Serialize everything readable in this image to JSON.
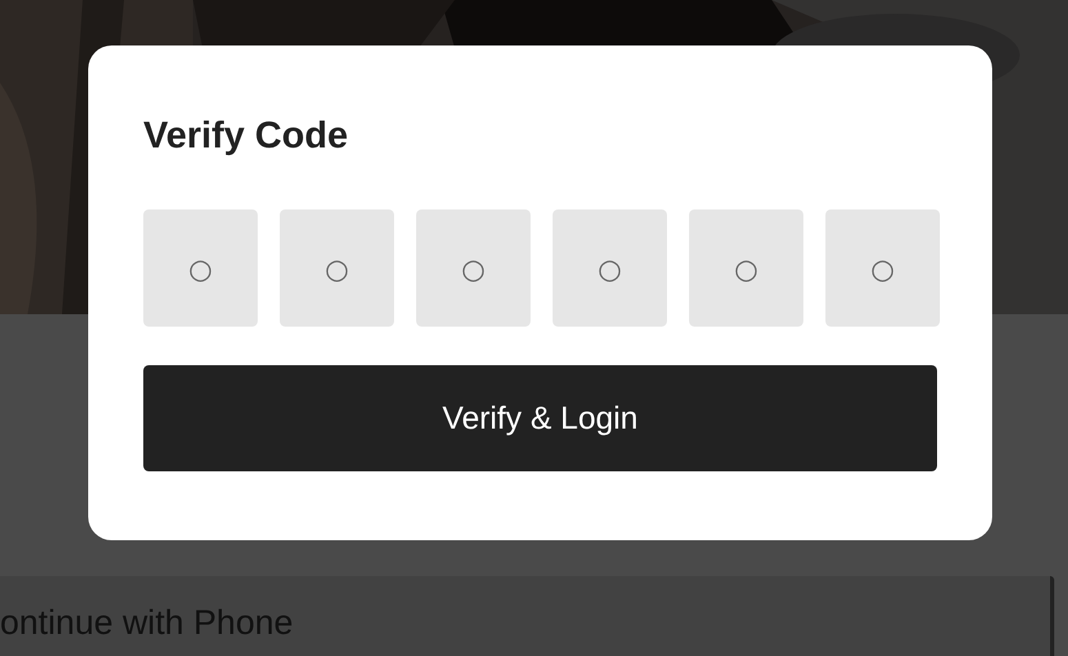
{
  "background": {
    "phone_button": {
      "label": "ontinue with Phone"
    }
  },
  "dialog": {
    "title": "Verify Code",
    "code_fields": [
      {
        "placeholder": "○"
      },
      {
        "placeholder": "○"
      },
      {
        "placeholder": "○"
      },
      {
        "placeholder": "○"
      },
      {
        "placeholder": "○"
      },
      {
        "placeholder": "○"
      }
    ],
    "submit_button": {
      "label": "Verify & Login"
    }
  }
}
